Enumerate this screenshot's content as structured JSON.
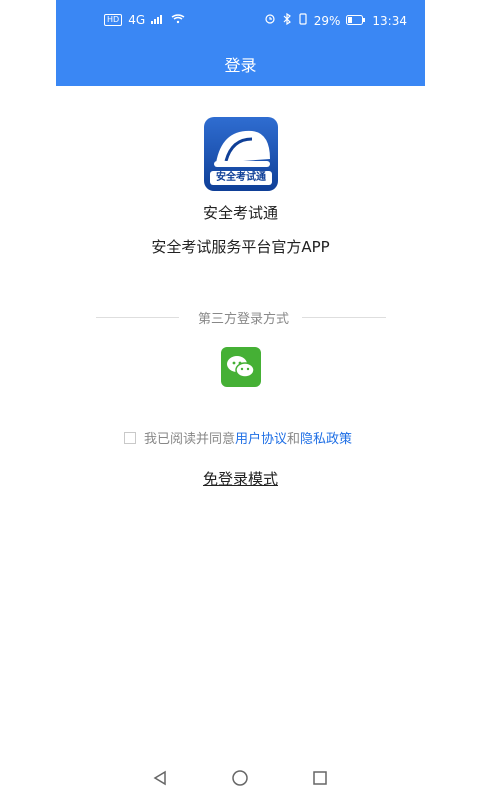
{
  "status_bar": {
    "hd_label": "HD",
    "network_label": "4G",
    "battery_text": "29%",
    "time": "13:34"
  },
  "header": {
    "title": "登录",
    "background_color": "#3a87f4"
  },
  "app": {
    "logo_text": "安全考试通",
    "name": "安全考试通",
    "subtitle": "安全考试服务平台官方APP"
  },
  "third_party": {
    "label": "第三方登录方式",
    "wechat_icon_name": "wechat-icon"
  },
  "agreement": {
    "prefix": "我已阅读并同意",
    "user_agreement": "用户协议",
    "conjunction": "和",
    "privacy_policy": "隐私政策"
  },
  "guest_mode": {
    "label": "免登录模式"
  },
  "nav": {
    "back_icon": "back-icon",
    "home_icon": "home-icon",
    "recent_icon": "recent-apps-icon"
  }
}
